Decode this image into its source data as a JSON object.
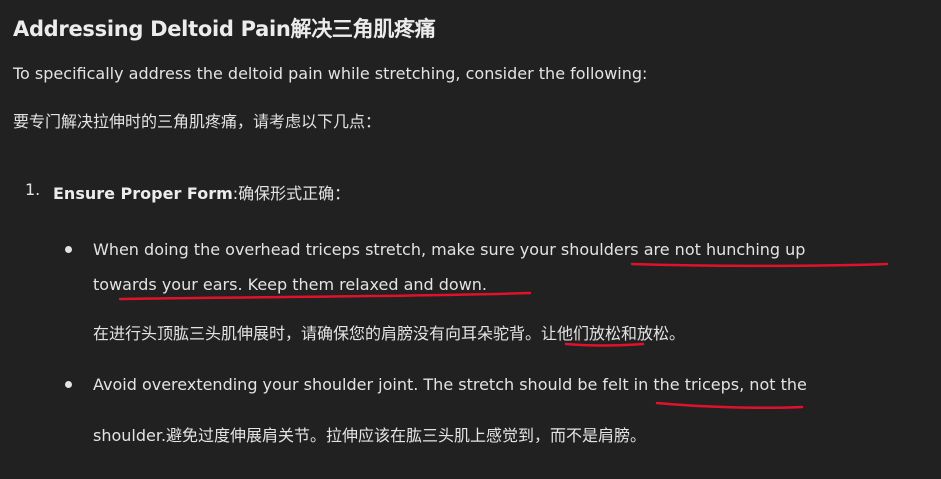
{
  "heading": "Addressing Deltoid Pain解决三角肌疼痛",
  "intro": {
    "en": "To specifically address the deltoid pain while stretching, consider the following:",
    "zh": "要专门解决拉伸时的三角肌疼痛，请考虑以下几点："
  },
  "list": {
    "number": "1.",
    "title_bold": "Ensure Proper Form",
    "title_rest": ":确保形式正确：",
    "bullets": [
      {
        "line1": "When doing the overhead triceps stretch, make sure your shoulders are not hunching up",
        "line2": "towards your ears. Keep them relaxed and down.",
        "line3": "在进行头顶肱三头肌伸展时，请确保您的肩膀没有向耳朵驼背。让他们放松和放松。"
      },
      {
        "line1": "Avoid overextending your shoulder joint. The stretch should be felt in the triceps, not the",
        "line2": "shoulder.避免过度伸展肩关节。拉伸应该在肱三头肌上感觉到，而不是肩膀。"
      }
    ]
  },
  "annotation_color": "#e0122b"
}
